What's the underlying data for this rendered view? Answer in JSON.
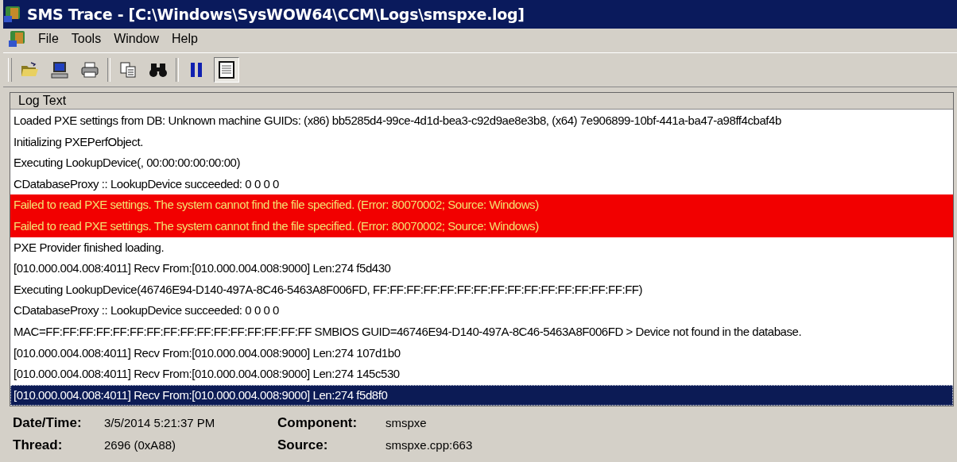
{
  "window": {
    "title": "SMS Trace - [C:\\Windows\\SysWOW64\\CCM\\Logs\\smspxe.log]"
  },
  "menu": [
    "File",
    "Tools",
    "Window",
    "Help"
  ],
  "toolbar": [
    {
      "kind": "open",
      "pressed": false
    },
    {
      "kind": "computer",
      "pressed": false
    },
    {
      "kind": "print",
      "pressed": false
    },
    {
      "kind": "separator"
    },
    {
      "kind": "copy",
      "pressed": false
    },
    {
      "kind": "find",
      "pressed": false
    },
    {
      "kind": "separator"
    },
    {
      "kind": "pause",
      "pressed": false
    },
    {
      "kind": "details",
      "pressed": true
    }
  ],
  "table": {
    "columns": [
      "Log Text"
    ],
    "rows": [
      {
        "text": "Loaded PXE settings from DB: Unknown machine GUIDs: (x86) bb5285d4-99ce-4d1d-bea3-c92d9ae8e3b8, (x64) 7e906899-10bf-441a-ba47-a98ff4cbaf4b",
        "kind": "info",
        "selected": false
      },
      {
        "text": "Initializing PXEPerfObject.",
        "kind": "info",
        "selected": false
      },
      {
        "text": "Executing LookupDevice(, 00:00:00:00:00:00)",
        "kind": "info",
        "selected": false
      },
      {
        "text": "CDatabaseProxy :: LookupDevice succeeded: 0 0 0 0",
        "kind": "info",
        "selected": false
      },
      {
        "text": "Failed to read PXE settings. The system cannot find the file specified. (Error: 80070002; Source: Windows)",
        "kind": "error",
        "selected": false
      },
      {
        "text": "Failed to read PXE settings. The system cannot find the file specified. (Error: 80070002; Source: Windows)",
        "kind": "error",
        "selected": false
      },
      {
        "text": "PXE Provider finished loading.",
        "kind": "info",
        "selected": false
      },
      {
        "text": "[010.000.004.008:4011] Recv From:[010.000.004.008:9000] Len:274 f5d430",
        "kind": "info",
        "selected": false
      },
      {
        "text": "Executing LookupDevice(46746E94-D140-497A-8C46-5463A8F006FD, FF:FF:FF:FF:FF:FF:FF:FF:FF:FF:FF:FF:FF:FF:FF:FF)",
        "kind": "info",
        "selected": false
      },
      {
        "text": "CDatabaseProxy :: LookupDevice succeeded: 0 0 0 0",
        "kind": "info",
        "selected": false
      },
      {
        "text": "MAC=FF:FF:FF:FF:FF:FF:FF:FF:FF:FF:FF:FF:FF:FF:FF:FF SMBIOS GUID=46746E94-D140-497A-8C46-5463A8F006FD > Device not found in the database.",
        "kind": "info",
        "selected": false
      },
      {
        "text": "[010.000.004.008:4011] Recv From:[010.000.004.008:9000] Len:274 107d1b0",
        "kind": "info",
        "selected": false
      },
      {
        "text": "[010.000.004.008:4011] Recv From:[010.000.004.008:9000] Len:274 145c530",
        "kind": "info",
        "selected": false
      },
      {
        "text": "[010.000.004.008:4011] Recv From:[010.000.004.008:9000] Len:274 f5d8f0",
        "kind": "info",
        "selected": true
      }
    ]
  },
  "details": [
    {
      "label": "Date/Time:",
      "value": "3/5/2014 5:21:37 PM"
    },
    {
      "label": "Component:",
      "value": "smspxe"
    },
    {
      "label": "Thread:",
      "value": "2696 (0xA88)"
    },
    {
      "label": "Source:",
      "value": "smspxe.cpp:663"
    }
  ]
}
